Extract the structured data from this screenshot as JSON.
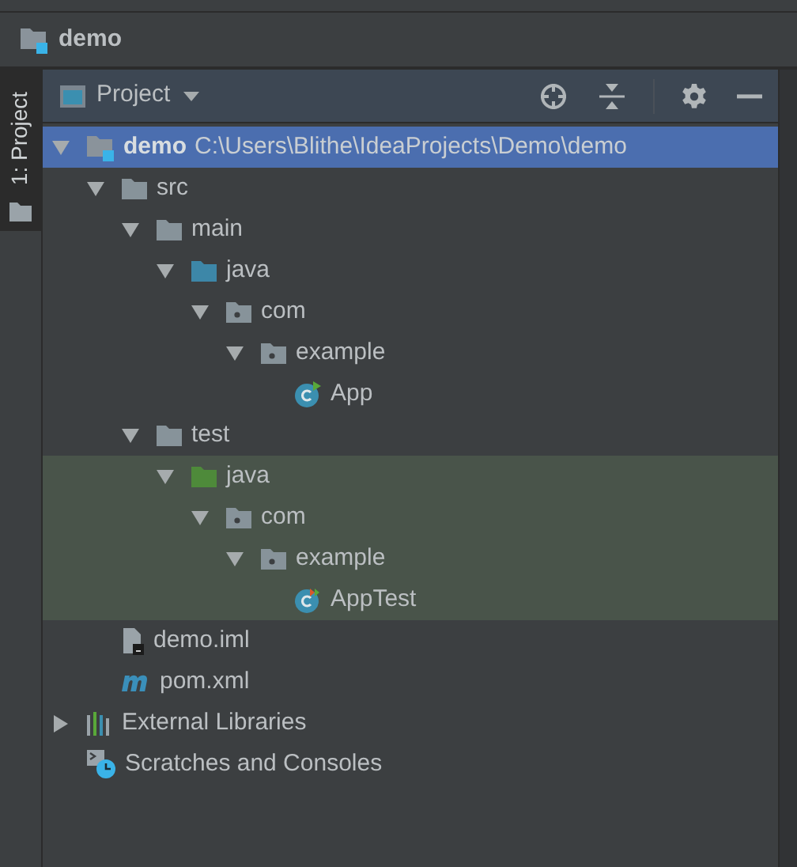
{
  "breadcrumb": {
    "title": "demo"
  },
  "tool_strip": {
    "label": "1: Project"
  },
  "panel": {
    "view": "Project"
  },
  "tree": [
    {
      "name": "demo",
      "path": "C:\\Users\\Blithe\\IdeaProjects\\Demo\\demo",
      "kind": "module",
      "expanded": true,
      "selected": true,
      "highlighted": false,
      "children": [
        {
          "name": "src",
          "kind": "folder",
          "expanded": true,
          "selected": false,
          "highlighted": false,
          "children": [
            {
              "name": "main",
              "kind": "folder",
              "expanded": true,
              "selected": false,
              "highlighted": false,
              "children": [
                {
                  "name": "java",
                  "kind": "source",
                  "expanded": true,
                  "selected": false,
                  "highlighted": false,
                  "children": [
                    {
                      "name": "com",
                      "kind": "package",
                      "expanded": true,
                      "selected": false,
                      "highlighted": false,
                      "children": [
                        {
                          "name": "example",
                          "kind": "package",
                          "expanded": true,
                          "selected": false,
                          "highlighted": false,
                          "children": [
                            {
                              "name": "App",
                              "kind": "class",
                              "selected": false,
                              "highlighted": false
                            }
                          ]
                        }
                      ]
                    }
                  ]
                }
              ]
            },
            {
              "name": "test",
              "kind": "folder",
              "expanded": true,
              "selected": false,
              "highlighted": false,
              "children": [
                {
                  "name": "java",
                  "kind": "test",
                  "expanded": true,
                  "selected": false,
                  "highlighted": true,
                  "children": [
                    {
                      "name": "com",
                      "kind": "package",
                      "expanded": true,
                      "selected": false,
                      "highlighted": true,
                      "children": [
                        {
                          "name": "example",
                          "kind": "package",
                          "expanded": true,
                          "selected": false,
                          "highlighted": true,
                          "children": [
                            {
                              "name": "AppTest",
                              "kind": "testclass",
                              "selected": false,
                              "highlighted": true
                            }
                          ]
                        }
                      ]
                    }
                  ]
                }
              ]
            }
          ]
        },
        {
          "name": "demo.iml",
          "kind": "iml",
          "selected": false,
          "highlighted": false
        },
        {
          "name": "pom.xml",
          "kind": "maven",
          "selected": false,
          "highlighted": false
        }
      ]
    },
    {
      "name": "External Libraries",
      "kind": "libraries",
      "expanded": false,
      "selected": false,
      "highlighted": false
    },
    {
      "name": "Scratches and Consoles",
      "kind": "scratches",
      "selected": false,
      "highlighted": false
    }
  ]
}
